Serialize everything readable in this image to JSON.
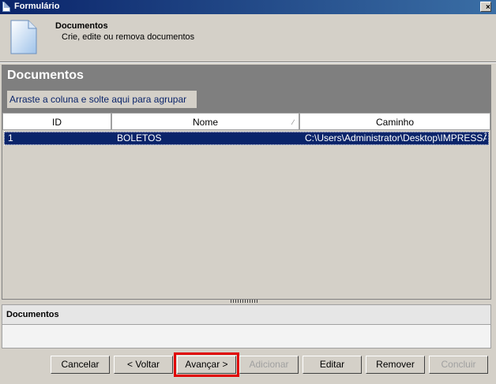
{
  "window": {
    "title": "Formulário",
    "close_glyph": "×"
  },
  "header": {
    "title": "Documentos",
    "subtitle": "Crie, edite ou remova documentos",
    "icon": "document-icon"
  },
  "panel": {
    "title": "Documentos",
    "group_hint": "Arraste a coluna e solte aqui para agrupar"
  },
  "table": {
    "columns": [
      "ID",
      "Nome",
      "Caminho"
    ],
    "sorted_column": "Nome",
    "rows": [
      {
        "id": "1",
        "nome": "BOLETOS",
        "caminho": "C:\\Users\\Administrator\\Desktop\\IMPRESSÃO",
        "selected": true
      }
    ]
  },
  "detail": {
    "title": "Documentos"
  },
  "buttons": {
    "cancel": "Cancelar",
    "back": "< Voltar",
    "next": "Avançar >",
    "add": "Adicionar",
    "edit": "Editar",
    "remove": "Remover",
    "finish": "Concluir"
  },
  "colors": {
    "title_bar": "#0a246a",
    "selection": "#0a246a",
    "highlight": "#e00000"
  }
}
